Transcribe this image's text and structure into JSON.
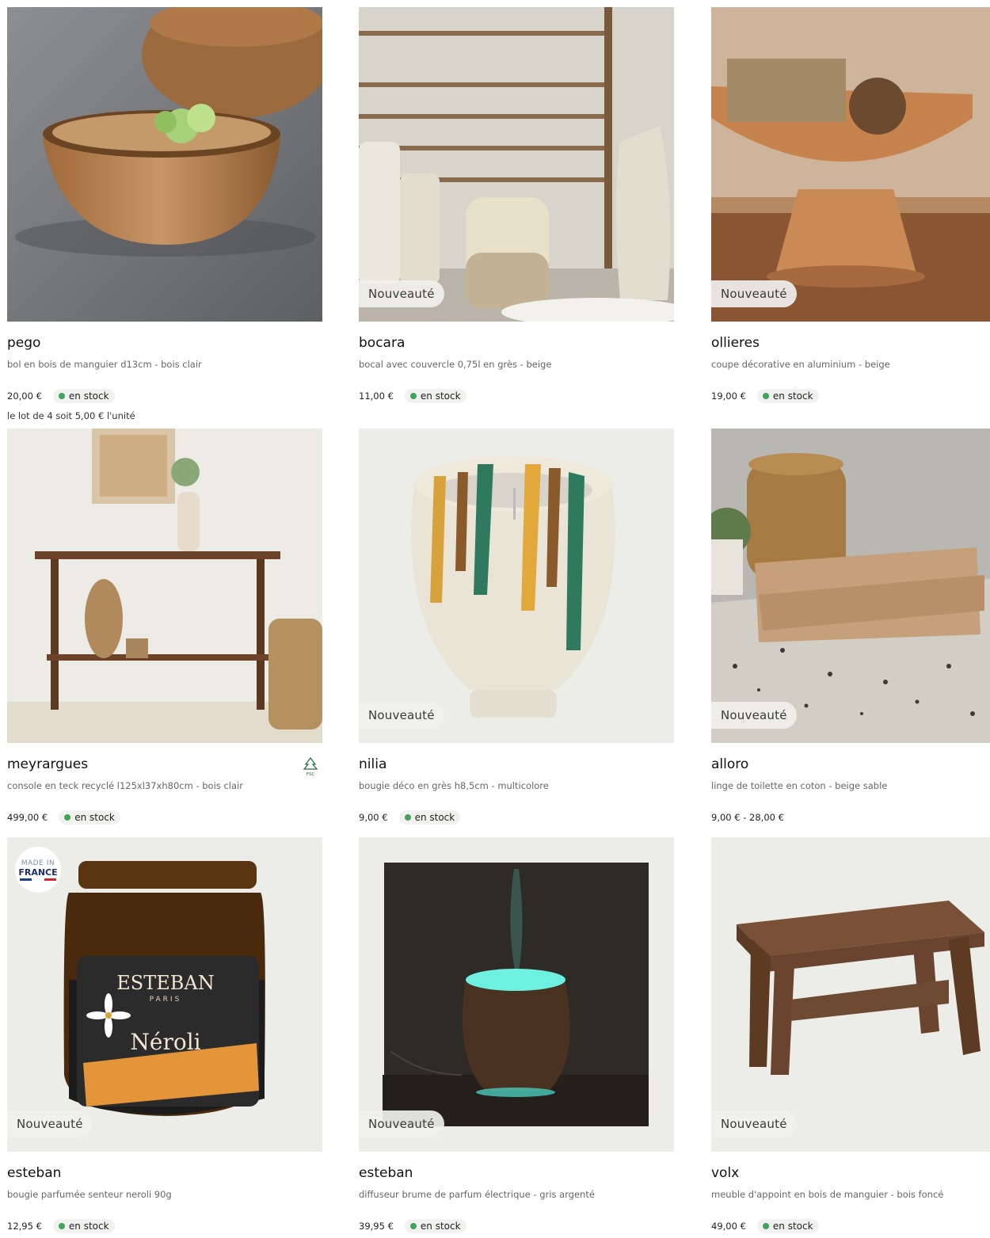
{
  "products": [
    {
      "name": "pego",
      "desc": "bol en bois de manguier d13cm - bois clair",
      "price": "20,00 €",
      "stock": "en stock",
      "note": "le lot de 4 soit 5,00 € l'unité",
      "badge": ""
    },
    {
      "name": "bocara",
      "desc": "bocal avec couvercle 0,75l en grès - beige",
      "price": "11,00 €",
      "stock": "en stock",
      "badge": "Nouveauté"
    },
    {
      "name": "ollieres",
      "desc": "coupe décorative en aluminium - beige",
      "price": "19,00 €",
      "stock": "en stock",
      "badge": "Nouveauté"
    },
    {
      "name": "meyrargues",
      "desc": "console en teck recyclé l125xl37xh80cm - bois clair",
      "price": "499,00 €",
      "stock": "en stock",
      "badge": "",
      "certification": "FSC"
    },
    {
      "name": "nilia",
      "desc": "bougie déco en grès h8,5cm - multicolore",
      "price": "9,00 €",
      "stock": "en stock",
      "badge": "Nouveauté"
    },
    {
      "name": "alloro",
      "desc": "linge de toilette en coton - beige sable",
      "price": "9,00 € - 28,00 €",
      "badge": "Nouveauté"
    },
    {
      "name": "esteban",
      "desc": "bougie parfumée senteur neroli 90g",
      "price": "12,95 €",
      "stock": "en stock",
      "badge": "Nouveauté",
      "made_in": {
        "line1": "MADE IN",
        "line2": "FRANCE"
      },
      "label": {
        "brand": "ESTEBAN",
        "city": "PARIS",
        "scent": "Néroli"
      }
    },
    {
      "name": "esteban",
      "desc": "diffuseur brume de parfum électrique - gris argenté",
      "price": "39,95 €",
      "stock": "en stock",
      "badge": "Nouveauté"
    },
    {
      "name": "volx",
      "desc": "meuble d'appoint en bois de manguier - bois foncé",
      "price": "49,00 €",
      "stock": "en stock",
      "badge": "Nouveauté"
    }
  ],
  "colors": {
    "stock_dot": "#3fa35a",
    "badge_bg": "#f0f0ed",
    "image_bg": "#eef0ec"
  }
}
